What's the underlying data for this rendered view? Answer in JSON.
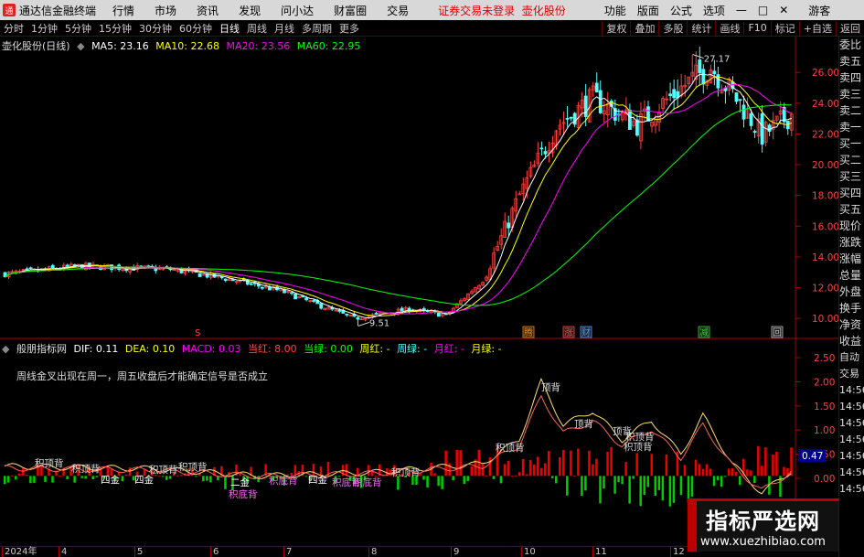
{
  "menubar": {
    "logo_glyph": "通",
    "app_title": "通达信金融终端",
    "items": [
      "行情",
      "市场",
      "资讯",
      "发现",
      "问小达",
      "财富圈",
      "交易"
    ],
    "notice": "证券交易未登录",
    "stock_name": "壶化股份",
    "right_items": [
      "功能",
      "版面",
      "公式",
      "选项"
    ],
    "user": "游客"
  },
  "toolbar": {
    "tabs": [
      "分时",
      "1分钟",
      "5分钟",
      "15分钟",
      "30分钟",
      "60分钟",
      "日线",
      "周线",
      "月线",
      "多周期",
      "更多"
    ],
    "active_tab": "日线",
    "right_tabs": [
      "复权",
      "叠加",
      "多股",
      "统计",
      "画线",
      "F10",
      "标记",
      "+自选",
      "返回"
    ]
  },
  "kline": {
    "stock_label": "壶化股份(日线)",
    "ma5": "MA5: 23.16",
    "ma10": "MA10: 22.68",
    "ma20": "MA20: 23.56",
    "ma60": "MA60: 22.95",
    "high_label": "27.17",
    "low_label": "9.51",
    "y_ticks": [
      "26.00",
      "24.00",
      "22.00",
      "20.00",
      "18.00",
      "16.00",
      "14.00",
      "12.00",
      "10.00"
    ],
    "markers": [
      "S",
      "腾",
      "涨",
      "财",
      "减",
      "回"
    ],
    "colors": {
      "up": "#ff4040",
      "down": "#54fcfc",
      "ma5": "#ffffff",
      "ma10": "#ffff00",
      "ma20": "#ff00ff",
      "ma60": "#00ff00"
    }
  },
  "indicator": {
    "name": "般朋指标网",
    "dif": "DIF: 0.11",
    "dea": "DEA: 0.10",
    "macd": "MACD: 0.03",
    "dang_hong": "当红: 8.00",
    "dang_lv": "当绿: 0.00",
    "zhou_hong": "周红: -",
    "zhou_lv": "周绿: -",
    "yue_hong": "月红: -",
    "yue_lv": "月绿: -",
    "note": "周线金叉出现在周一，周五收盘后才能确定信号是否成立",
    "y_ticks": [
      "2.50",
      "2.00",
      "1.50",
      "1.00",
      "0.50",
      "0.00"
    ],
    "current_value": "0.47",
    "signal_labels": [
      "积顶背",
      "积顶背",
      "四金",
      "四金",
      "积顶背",
      "积顶背",
      "二金",
      "积底背",
      "积底背",
      "四金",
      "积底背",
      "积底背",
      "积顶背",
      "积顶背",
      "顶背",
      "顶背",
      "顶背",
      "积顶背",
      "积顶背"
    ]
  },
  "sidebar": {
    "items": [
      "委比",
      "卖五",
      "卖四",
      "卖三",
      "卖二",
      "卖一",
      "买一",
      "买二",
      "买三",
      "买四",
      "买五",
      "现价",
      "涨跌",
      "涨幅",
      "总量",
      "外盘",
      "换手",
      "净资",
      "收益",
      "自动",
      "交易",
      "14:56",
      "14:56",
      "14:56",
      "14:56",
      "14:56",
      "14:56",
      "14:56"
    ]
  },
  "date_axis": {
    "labels": [
      "2024年",
      "4",
      "5",
      "6",
      "7",
      "8",
      "9",
      "10",
      "11",
      "12"
    ]
  },
  "watermark": {
    "title": "指标严选网",
    "url": "www.xuezhibiao.com"
  }
}
